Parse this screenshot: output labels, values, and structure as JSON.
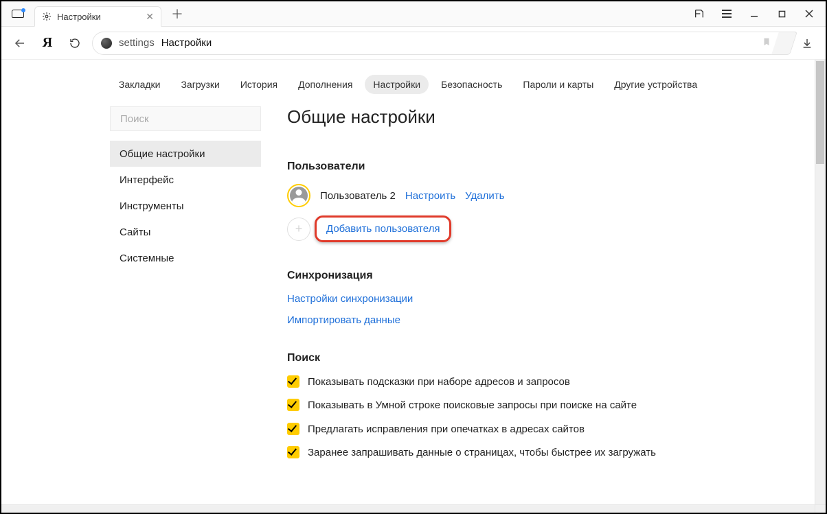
{
  "browser": {
    "tab_title": "Настройки",
    "address": {
      "host": "settings",
      "page": "Настройки"
    }
  },
  "topnav": {
    "items": [
      "Закладки",
      "Загрузки",
      "История",
      "Дополнения",
      "Настройки",
      "Безопасность",
      "Пароли и карты",
      "Другие устройства"
    ],
    "active_index": 4
  },
  "sidebar": {
    "search_placeholder": "Поиск",
    "items": [
      "Общие настройки",
      "Интерфейс",
      "Инструменты",
      "Сайты",
      "Системные"
    ],
    "active_index": 0
  },
  "page": {
    "title": "Общие настройки",
    "users": {
      "heading": "Пользователи",
      "row": {
        "name": "Пользователь 2",
        "configure": "Настроить",
        "delete": "Удалить"
      },
      "add_label": "Добавить пользователя"
    },
    "sync": {
      "heading": "Синхронизация",
      "links": [
        "Настройки синхронизации",
        "Импортировать данные"
      ]
    },
    "search": {
      "heading": "Поиск",
      "items": [
        "Показывать подсказки при наборе адресов и запросов",
        "Показывать в Умной строке поисковые запросы при поиске на сайте",
        "Предлагать исправления при опечатках в адресах сайтов",
        "Заранее запрашивать данные о страницах, чтобы быстрее их загружать"
      ]
    }
  }
}
